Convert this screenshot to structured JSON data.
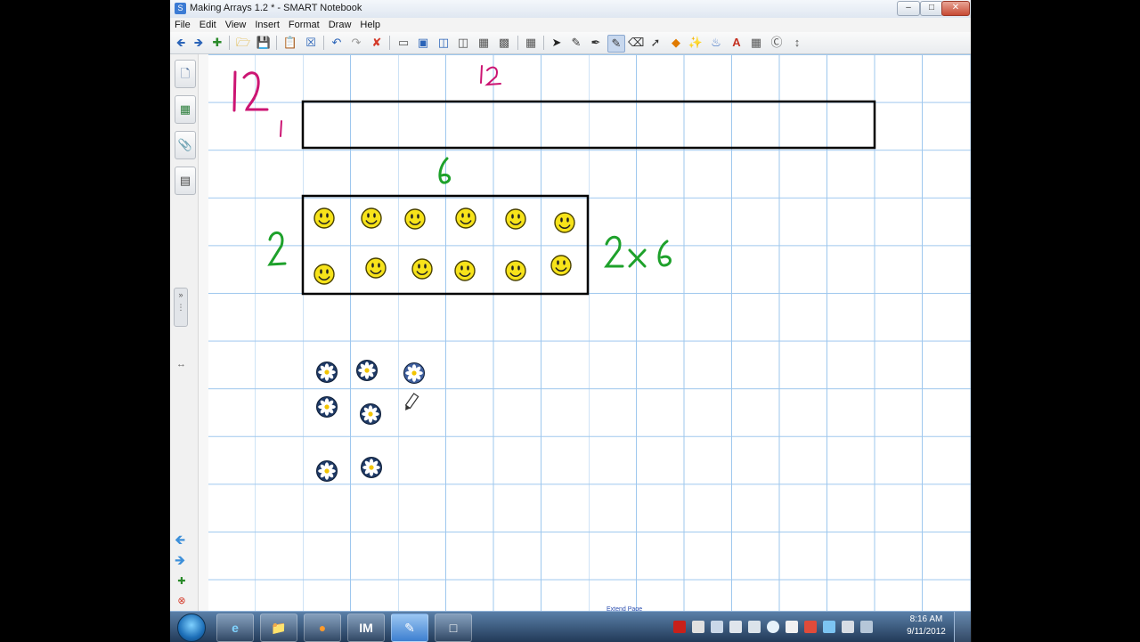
{
  "window": {
    "title": "Making Arrays 1.2 * - SMART Notebook",
    "app_icon": "smart-notebook-icon",
    "controls": [
      "minimize",
      "maximize",
      "close"
    ]
  },
  "menu": [
    "File",
    "Edit",
    "View",
    "Insert",
    "Format",
    "Draw",
    "Help"
  ],
  "toolbar_icons": [
    "back-arrow-icon",
    "forward-arrow-icon",
    "add-page-icon",
    "open-folder-icon",
    "save-icon",
    "paste-icon",
    "delete-page-icon",
    "undo-icon",
    "redo-icon",
    "delete-icon",
    "screen-shade-icon",
    "full-screen-icon",
    "dual-page-icon",
    "document-camera-icon",
    "capture-icon",
    "insert-table-icon",
    "select-arrow-icon",
    "pen-icon",
    "creative-pen-icon",
    "highlighter-icon",
    "eraser-icon",
    "line-icon",
    "shapes-icon",
    "magic-pen-icon",
    "fill-icon",
    "text-icon",
    "properties-icon",
    "shape-recognition-icon",
    "move-toolbar-icon"
  ],
  "sidebar": {
    "tabs": [
      "page-sorter-icon",
      "gallery-icon",
      "attachments-icon",
      "properties-icon"
    ],
    "bottom": [
      "previous-page-icon",
      "next-page-icon",
      "add-page-icon",
      "delete-page-icon"
    ]
  },
  "canvas": {
    "texts": {
      "top_left": "12",
      "top_left_small": "1",
      "top_label": "12",
      "middle_label": "6",
      "row_label": "2",
      "equation": "2 x 6"
    },
    "smiley_rows": 2,
    "smiley_cols": 6,
    "flower_count": 7,
    "extend_page_label": "Extend Page"
  },
  "taskbar": {
    "apps": [
      "windows-start-orb",
      "internet-explorer-icon",
      "file-explorer-icon",
      "firefox-icon",
      "im-app-icon",
      "smart-notebook-task-icon",
      "screen-capture-icon"
    ],
    "im_label": "IM",
    "tray_icons": [
      "adobe-icon",
      "speaker-icon",
      "network-icon",
      "monitor-icon",
      "update-icon",
      "flash-icon",
      "security-icon",
      "sync-icon",
      "pen-icon",
      "volume-icon"
    ],
    "clock_time": "8:16 AM",
    "clock_date": "9/11/2012"
  }
}
